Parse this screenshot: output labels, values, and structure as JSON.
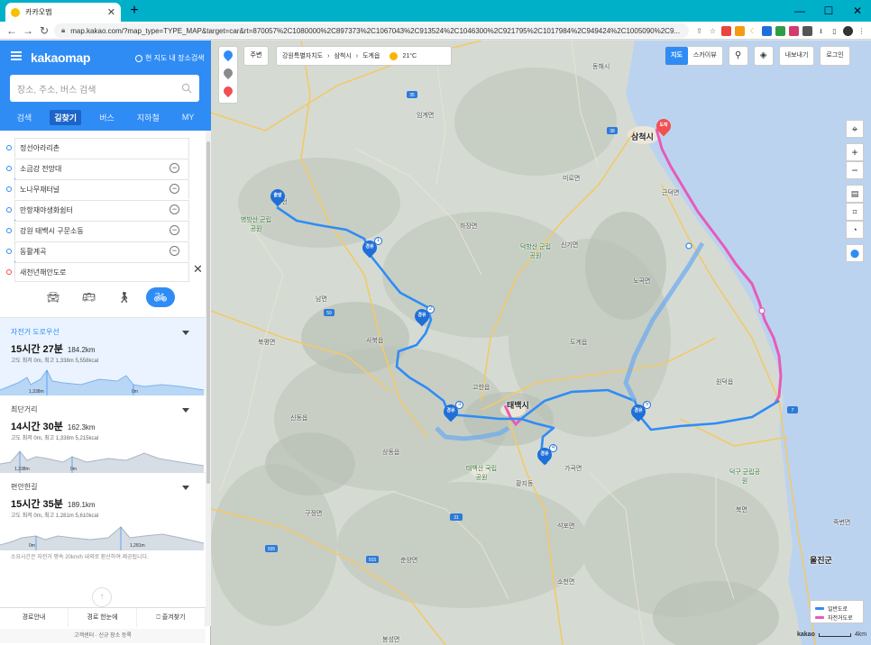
{
  "browser": {
    "tab_title": "카카오맵",
    "url": "map.kakao.com/?map_type=TYPE_MAP&target=car&rt=870057%2C1080000%2C897373%2C1067043%2C913524%2C1046300%2C921795%2C1017984%2C949424%2C1005090%2C9..."
  },
  "sidebar": {
    "logo": "kakaomap",
    "here_search": "현 지도 내 장소검색",
    "search_placeholder": "장소, 주소, 버스 검색",
    "tabs": [
      {
        "label": "검색"
      },
      {
        "label": "길찾기"
      },
      {
        "label": "버스"
      },
      {
        "label": "지하철"
      },
      {
        "label": "MY"
      }
    ],
    "waypoints": [
      {
        "label": "정선아라리촌"
      },
      {
        "label": "소금강 전망대"
      },
      {
        "label": "노나무재터널"
      },
      {
        "label": "만항재야생화쉼터"
      },
      {
        "label": "강원 태백시 구문소동"
      },
      {
        "label": "동활계곡"
      },
      {
        "label": "새천년해안도로"
      }
    ],
    "routes": [
      {
        "name": "자전거 도로우선",
        "time": "15시간 27분",
        "distance": "184.2km",
        "elev": "고도 최저 0m, 최고 1,338m   5,558kcal",
        "peak": "1,338m",
        "low": "0m"
      },
      {
        "name": "최단거리",
        "time": "14시간 30분",
        "distance": "162.3km",
        "elev": "고도 최저 0m, 최고 1,338m   5,215kcal",
        "peak": "1,338m",
        "low": "0m"
      },
      {
        "name": "편안한길",
        "time": "15시간 35분",
        "distance": "189.1km",
        "elev": "고도 최저 0m, 최고 1,281m   5,610kcal",
        "peak": "1,281m",
        "low": "0m"
      }
    ],
    "note": "소요시간은 자전거 평속 20km/h 내외로 환산하여 제공됩니다.",
    "bottom": {
      "guide": "경로안내",
      "overview": "경로 한눈에",
      "favorite": "즐겨찾기"
    },
    "footer": "고객센터 · 신규 장소 등록"
  },
  "map": {
    "around": "주변",
    "breadcrumb": [
      "강원특별자치도",
      "삼척시",
      "도계읍"
    ],
    "weather": "21°C",
    "view_map": "지도",
    "view_sky": "스카이뷰",
    "export": "내보내기",
    "login": "로그인",
    "pins": {
      "start": "출발",
      "end": "도착",
      "via": "경유"
    },
    "places": {
      "donghae": "동해시",
      "samcheok": "삼척시",
      "jeongseon": "정선",
      "taebaek": "태백시",
      "dogye": "도계읍",
      "hajang": "하장면",
      "miro": "미로면",
      "geundeok": "근덕면",
      "nogok": "노곡면",
      "wondeok": "원덕읍",
      "sindong": "신동읍",
      "sangdong": "상동읍",
      "uljin": "울진군",
      "seokpo": "석포면",
      "sobeon": "소천면",
      "nammyeon": "남면",
      "sabuk": "사북읍",
      "imgye": "임계면",
      "bukpyeong": "북평면",
      "gohan": "고한읍",
      "park_byeongbang": "병방산 군립공원",
      "park_deokhang": "덕항산 군립공원",
      "park_taebaek": "태백산 국립공원",
      "park_deokgu": "덕구 군립공원",
      "gagok": "가곡면",
      "jukbyeon": "죽변면",
      "chunyang": "춘양면",
      "bongseong": "봉성면",
      "singi": "신기면",
      "hwangji": "황지동",
      "gujeong": "구정면",
      "buk": "북면"
    },
    "legend": {
      "general": "일반도로",
      "bike": "자전거도로"
    },
    "scale": "4km",
    "brand": "kakao",
    "colors": {
      "general": "#2f8cf5",
      "bike": "#e85ab8"
    }
  }
}
